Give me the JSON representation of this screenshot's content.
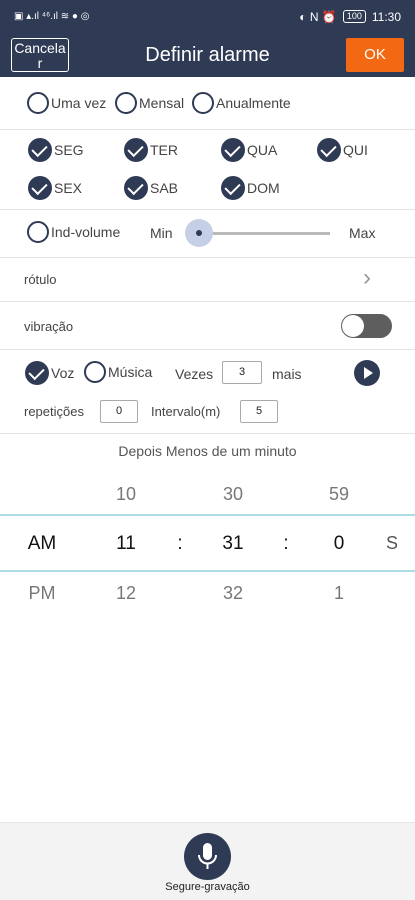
{
  "statusbar": {
    "left_icons": "▣ ▴.ıl ⁴⁶.ıl ≋ ● ◎",
    "right_icons": "◐ N ⏰",
    "battery": "100",
    "time": "11:30"
  },
  "header": {
    "cancel_label": "Cancelar",
    "title": "Definir alarme",
    "ok_label": "OK"
  },
  "repeat_modes": [
    {
      "label": "Uma vez",
      "selected": false
    },
    {
      "label": "Mensal",
      "selected": false
    },
    {
      "label": "Anualmente",
      "selected": false
    }
  ],
  "days": [
    {
      "label": "SEG",
      "checked": true
    },
    {
      "label": "TER",
      "checked": true
    },
    {
      "label": "QUA",
      "checked": true
    },
    {
      "label": "QUI",
      "checked": true
    },
    {
      "label": "SEX",
      "checked": true
    },
    {
      "label": "SAB",
      "checked": true
    },
    {
      "label": "DOM",
      "checked": true
    }
  ],
  "volume": {
    "ind_label": "Ind-volume",
    "min_label": "Min",
    "max_label": "Max",
    "level": 0
  },
  "label_row": {
    "label": "rótulo",
    "chevron": "›"
  },
  "vibration": {
    "label": "vibração",
    "enabled": false
  },
  "sound": {
    "voz_label": "Voz",
    "voz_checked": true,
    "musica_label": "Música",
    "musica_checked": false,
    "vezes_label": "Vezes",
    "vezes_value": "3",
    "mais_label": "mais"
  },
  "repeat": {
    "repeticoes_label": "repetições",
    "repeticoes_value": "0",
    "intervalo_label": "Intervalo(m)",
    "intervalo_value": "5"
  },
  "countdown_text": "Depois Menos de um minuto",
  "picker": {
    "above": {
      "hour": "10",
      "minute": "30",
      "second": "59"
    },
    "selected": {
      "ampm": "AM",
      "hour": "11",
      "minute": "31",
      "second": "0",
      "sep1": ":",
      "sep2": ":",
      "unit": "S"
    },
    "below": {
      "ampm": "PM",
      "hour": "12",
      "minute": "32",
      "second": "1"
    }
  },
  "bottom": {
    "record_label": "Segure-gravação"
  },
  "colors": {
    "primary": "#2f3a55",
    "accent": "#f36812"
  }
}
